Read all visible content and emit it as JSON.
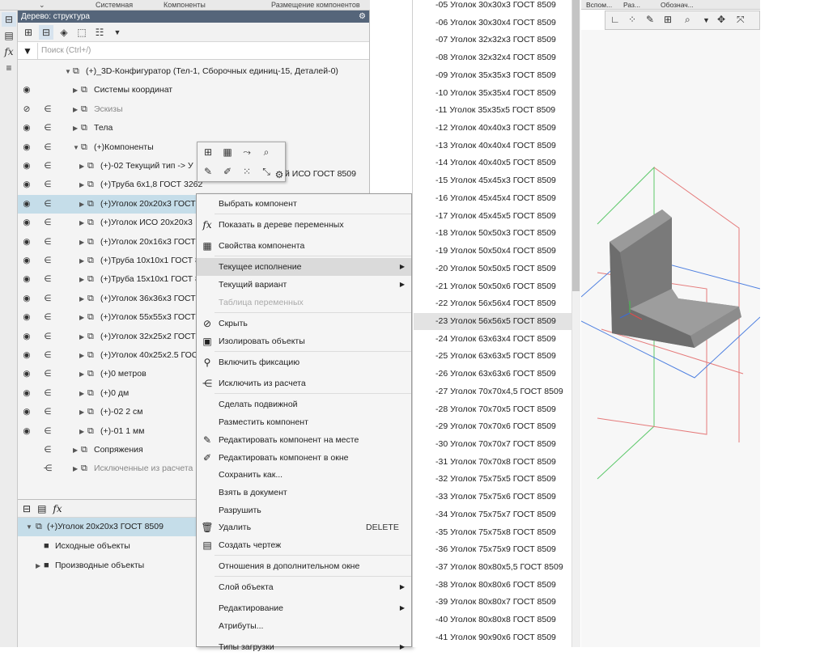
{
  "top_tabs": [
    "Системная",
    "Компоненты",
    "Размещение компонентов"
  ],
  "tree": {
    "header": "Дерево: структура",
    "search_placeholder": "Поиск (Ctrl+/)",
    "rows": [
      {
        "label": "(+)_3D-Конфигуратор (Тел-1, Сборочных единиц-15, Деталей-0)",
        "eye": "",
        "dep": "",
        "indent": 0
      },
      {
        "label": "Системы координат",
        "eye": "◉",
        "dep": "",
        "indent": 1
      },
      {
        "label": "Эскизы",
        "eye": "⊘",
        "dep": "∈",
        "indent": 1,
        "gray": true
      },
      {
        "label": "Тела",
        "eye": "◉",
        "dep": "∈",
        "indent": 1
      },
      {
        "label": "(+)Компоненты",
        "eye": "◉",
        "dep": "∈",
        "indent": 1
      },
      {
        "label": "(+)-02 Текущий тип -> У",
        "eye": "◉",
        "dep": "∈",
        "indent": 2
      },
      {
        "label": "(+)Труба 6x1,8 ГОСТ 3262",
        "eye": "◉",
        "dep": "∈",
        "indent": 2
      },
      {
        "label": "(+)Уголок 20x20x3 ГОСТ",
        "eye": "◉",
        "dep": "∈",
        "indent": 2,
        "selected": true
      },
      {
        "label": "(+)Уголок ИСО 20x20x3",
        "eye": "◉",
        "dep": "∈",
        "indent": 2
      },
      {
        "label": "(+)Уголок 20x16x3 ГОСТ",
        "eye": "◉",
        "dep": "∈",
        "indent": 2
      },
      {
        "label": "(+)Труба 10x10x1 ГОСТ 8",
        "eye": "◉",
        "dep": "∈",
        "indent": 2
      },
      {
        "label": "(+)Труба 15x10x1 ГОСТ 8",
        "eye": "◉",
        "dep": "∈",
        "indent": 2
      },
      {
        "label": "(+)Уголок 36x36x3 ГОСТ",
        "eye": "◉",
        "dep": "∈",
        "indent": 2
      },
      {
        "label": "(+)Уголок 55x55x3 ГОСТ",
        "eye": "◉",
        "dep": "∈",
        "indent": 2
      },
      {
        "label": "(+)Уголок 32x25x2 ГОСТ",
        "eye": "◉",
        "dep": "∈",
        "indent": 2
      },
      {
        "label": "(+)Уголок 40x25x2.5 ГОС",
        "eye": "◉",
        "dep": "∈",
        "indent": 2
      },
      {
        "label": "(+)0 метров",
        "eye": "◉",
        "dep": "∈",
        "indent": 2
      },
      {
        "label": "(+)0 дм",
        "eye": "◉",
        "dep": "∈",
        "indent": 2
      },
      {
        "label": "(+)-02 2 см",
        "eye": "◉",
        "dep": "∈",
        "indent": 2
      },
      {
        "label": "(+)-01 1 мм",
        "eye": "◉",
        "dep": "∈",
        "indent": 2
      },
      {
        "label": "Сопряжения",
        "eye": "",
        "dep": "∈",
        "indent": 1
      },
      {
        "label": "Исключенные из расчета",
        "eye": "",
        "dep": "⋲",
        "indent": 1,
        "gray": true
      }
    ],
    "right_fragment": "й ИСО ГОСТ 8509"
  },
  "lower": {
    "rows": [
      {
        "label": "(+)Уголок 20x20x3 ГОСТ 8509",
        "selected": true
      },
      {
        "label": "Исходные объекты"
      },
      {
        "label": "Производные объекты"
      }
    ]
  },
  "context_menu": [
    {
      "label": "Выбрать компонент",
      "icon": ""
    },
    {
      "label": "Показать в дереве переменных",
      "icon": "fx"
    },
    {
      "label": "Свойства компонента",
      "icon": "▦"
    },
    {
      "label": "Текущее исполнение",
      "icon": "",
      "submenu": true,
      "hover": true
    },
    {
      "label": "Текущий вариант",
      "icon": "",
      "submenu": true
    },
    {
      "label": "Таблица переменных",
      "icon": "",
      "disabled": true
    },
    {
      "label": "Скрыть",
      "icon": "⊘"
    },
    {
      "label": "Изолировать объекты",
      "icon": "▣"
    },
    {
      "label": "Включить фиксацию",
      "icon": "⚲"
    },
    {
      "label": "Исключить из расчета",
      "icon": "⋲"
    },
    {
      "label": "Сделать подвижной",
      "icon": ""
    },
    {
      "label": "Разместить компонент",
      "icon": ""
    },
    {
      "label": "Редактировать компонент на месте",
      "icon": "✎"
    },
    {
      "label": "Редактировать компонент в окне",
      "icon": "✐"
    },
    {
      "label": "Сохранить как...",
      "icon": ""
    },
    {
      "label": "Взять в документ",
      "icon": ""
    },
    {
      "label": "Разрушить",
      "icon": ""
    },
    {
      "label": "Удалить",
      "icon": "🗑",
      "shortcut": "DELETE"
    },
    {
      "label": "Создать чертеж",
      "icon": "▤"
    },
    {
      "label": "Отношения в дополнительном окне",
      "icon": ""
    },
    {
      "label": "Слой объекта",
      "icon": "",
      "submenu": true
    },
    {
      "label": "Редактирование",
      "icon": "",
      "submenu": true
    },
    {
      "label": "Атрибуты...",
      "icon": ""
    },
    {
      "label": "Типы загрузки",
      "icon": "",
      "submenu": true
    }
  ],
  "submenu": [
    "-05 Уголок 30x30x3 ГОСТ 8509",
    "-06 Уголок 30x30x4 ГОСТ 8509",
    "-07 Уголок 32x32x3 ГОСТ 8509",
    "-08 Уголок 32x32x4 ГОСТ 8509",
    "-09 Уголок 35x35x3 ГОСТ 8509",
    "-10 Уголок 35x35x4 ГОСТ 8509",
    "-11 Уголок 35x35x5 ГОСТ 8509",
    "-12 Уголок 40x40x3 ГОСТ 8509",
    "-13 Уголок 40x40x4 ГОСТ 8509",
    "-14 Уголок 40x40x5 ГОСТ 8509",
    "-15 Уголок 45x45x3 ГОСТ 8509",
    "-16 Уголок 45x45x4 ГОСТ 8509",
    "-17 Уголок 45x45x5 ГОСТ 8509",
    "-18 Уголок 50x50x3 ГОСТ 8509",
    "-19 Уголок 50x50x4 ГОСТ 8509",
    "-20 Уголок 50x50x5 ГОСТ 8509",
    "-21 Уголок 50x50x6 ГОСТ 8509",
    "-22 Уголок 56x56x4 ГОСТ 8509",
    "-23 Уголок 56x56x5 ГОСТ 8509",
    "-24 Уголок 63x63x4 ГОСТ 8509",
    "-25 Уголок 63x63x5 ГОСТ 8509",
    "-26 Уголок 63x63x6 ГОСТ 8509",
    "-27 Уголок 70x70x4,5 ГОСТ 8509",
    "-28 Уголок 70x70x5 ГОСТ 8509",
    "-29 Уголок 70x70x6 ГОСТ 8509",
    "-30 Уголок 70x70x7 ГОСТ 8509",
    "-31 Уголок 70x70x8 ГОСТ 8509",
    "-32 Уголок 75x75x5 ГОСТ 8509",
    "-33 Уголок 75x75x6 ГОСТ 8509",
    "-34 Уголок 75x75x7 ГОСТ 8509",
    "-35 Уголок 75x75x8 ГОСТ 8509",
    "-36 Уголок 75x75x9 ГОСТ 8509",
    "-37 Уголок 80x80x5,5 ГОСТ 8509",
    "-38 Уголок 80x80x6 ГОСТ 8509",
    "-39 Уголок 80x80x7 ГОСТ 8509",
    "-40 Уголок 80x80x8 ГОСТ 8509",
    "-41 Уголок 90x90x6 ГОСТ 8509"
  ],
  "submenu_selected_index": 18,
  "viewport_tabs": [
    "Вспом...",
    "Раз...",
    "Обознач..."
  ]
}
